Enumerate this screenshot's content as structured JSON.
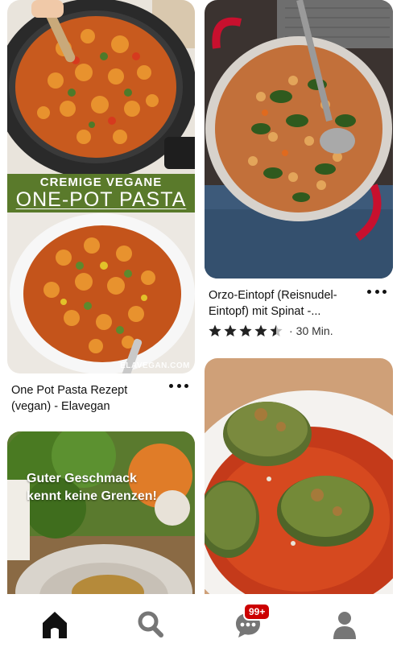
{
  "feed": {
    "pins": [
      {
        "id": "pasta",
        "title": "One Pot Pasta Rezept (vegan) - Elavegan",
        "overlay_line1": "CREMIGE VEGANE",
        "overlay_line2": "ONE-POT PASTA",
        "watermark": "ELAVEGAN.COM"
      },
      {
        "id": "orzo",
        "title": "Orzo-Eintopf (Reisnudel-Eintopf) mit Spinat -...",
        "rating": 4.5,
        "time": "30 Min."
      },
      {
        "id": "promo",
        "overlay_line1": "Guter Geschmack",
        "overlay_line2": "kennt keine Grenzen!"
      },
      {
        "id": "patties"
      }
    ],
    "more_icon": "ellipsis-icon",
    "rating_separator": "·"
  },
  "nav": {
    "items": [
      {
        "name": "home",
        "icon": "home-icon",
        "active": true
      },
      {
        "name": "search",
        "icon": "search-icon"
      },
      {
        "name": "messages",
        "icon": "chat-icon"
      },
      {
        "name": "profile",
        "icon": "profile-icon"
      }
    ],
    "badge": "99+"
  },
  "colors": {
    "badge": "#cc0000",
    "overlay_band": "#5a7a2b",
    "pot_red": "#c8102e",
    "icon_active": "#111111",
    "icon_inactive": "#767676"
  }
}
